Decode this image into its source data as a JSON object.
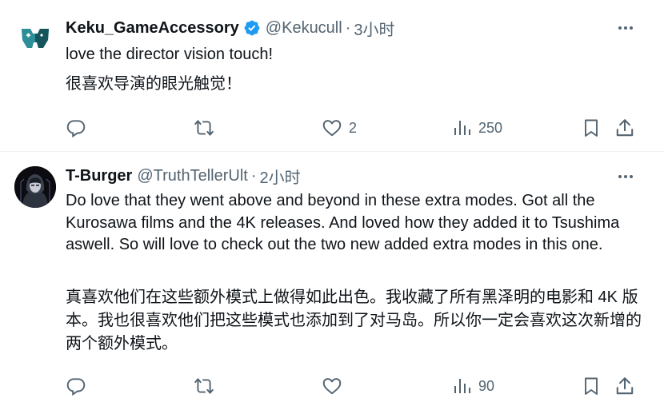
{
  "tweets": [
    {
      "display_name": "Keku_GameAccessory",
      "verified": true,
      "handle": "@Kekucull",
      "separator": "·",
      "time": "3小时",
      "text_en": "love the director vision touch!",
      "text_zh": "很喜欢导演的眼光触觉！",
      "reply_count": "",
      "retweet_count": "",
      "like_count": "2",
      "view_count": "250",
      "avatar_icon": "game-controller-logo-icon",
      "accent_color": "#1d9bf0"
    },
    {
      "display_name": "T-Burger",
      "verified": false,
      "handle": "@TruthTellerUlt",
      "separator": "·",
      "time": "2小时",
      "text_en": "Do love that they went above and beyond in these extra modes. Got all the Kurosawa films and the 4K releases. And loved how they added it to Tsushima aswell. So will love to check out the two new added extra modes in this one.",
      "text_zh": "真喜欢他们在这些额外模式上做得如此出色。我收藏了所有黑泽明的电影和 4K 版本。我也很喜欢他们把这些模式也添加到了对马岛。所以你一定会喜欢这次新增的两个额外模式。",
      "reply_count": "",
      "retweet_count": "",
      "like_count": "",
      "view_count": "90",
      "avatar_icon": "hooded-figure-avatar-icon"
    }
  ],
  "icons": {
    "reply": "reply-icon",
    "retweet": "retweet-icon",
    "like": "heart-icon",
    "views": "views-chart-icon",
    "bookmark": "bookmark-icon",
    "share": "share-icon",
    "more": "more-dots-icon",
    "verified": "verified-badge-icon"
  },
  "colors": {
    "text": "#0f1419",
    "secondary": "#536471",
    "verified": "#1d9bf0",
    "divider": "#eff3f4"
  }
}
